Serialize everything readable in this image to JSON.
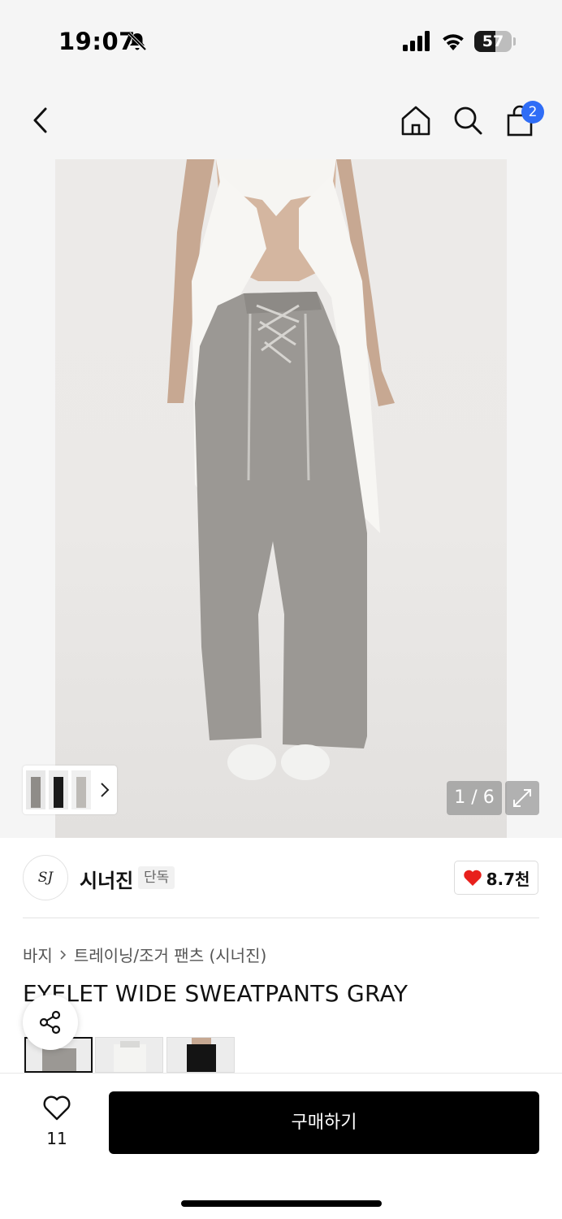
{
  "status_bar": {
    "time": "19:07",
    "battery": 57,
    "icons": [
      "bell-off-icon",
      "signal-icon",
      "wifi-icon",
      "battery-icon"
    ]
  },
  "top_nav": {
    "icons": [
      "back-icon",
      "home-icon",
      "search-icon",
      "cart-icon"
    ],
    "cart_count": "2"
  },
  "gallery": {
    "counter": "1 / 6",
    "icons": [
      "chevron-right-icon",
      "expand-icon"
    ]
  },
  "brand": {
    "logo_text": "SJ",
    "name": "시너진",
    "badge": "단독",
    "likes": "8.7천"
  },
  "breadcrumb": {
    "category": "바지",
    "subcategory": "트레이닝/조거 팬츠 (시너진)"
  },
  "product": {
    "title": "EYELET WIDE SWEATPANTS GRAY"
  },
  "colors": {
    "accent_blue": "#2f6df6",
    "like_red": "#e8201c",
    "button_black": "#000000"
  },
  "bottom_bar": {
    "wish_count": "11",
    "buy_label": "구매하기"
  }
}
